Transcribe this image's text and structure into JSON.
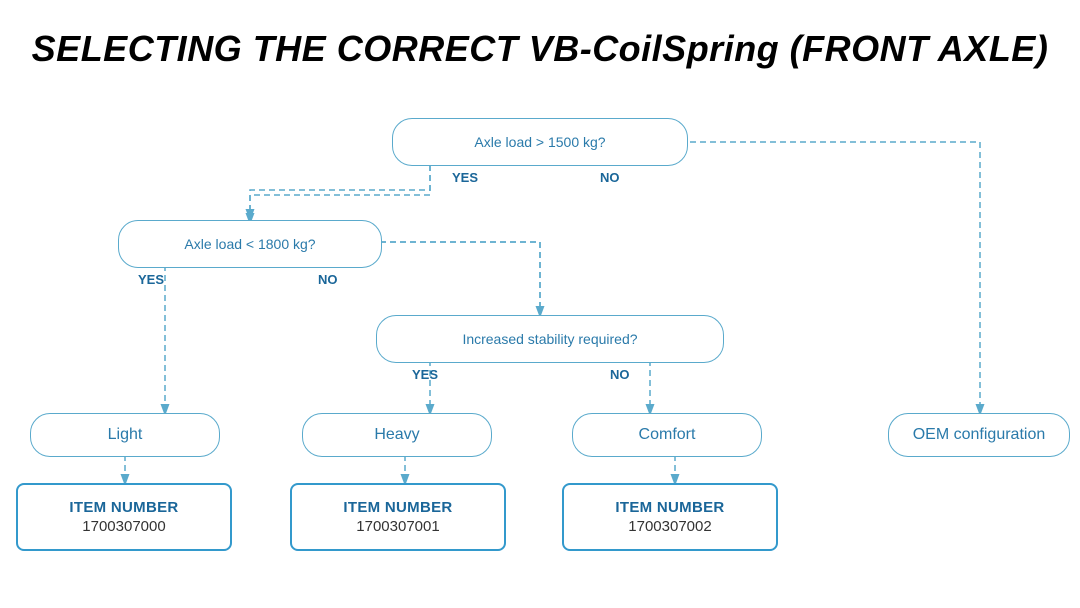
{
  "title": "SELECTING THE CORRECT VB-CoilSpring (FRONT AXLE)",
  "diagram": {
    "decision1": {
      "text": "Axle load > 1500 kg?",
      "yes": "YES",
      "no": "NO"
    },
    "decision2": {
      "text": "Axle load < 1800 kg?",
      "yes": "YES",
      "no": "NO"
    },
    "decision3": {
      "text": "Increased stability required?",
      "yes": "YES",
      "no": "NO"
    },
    "results": {
      "light": "Light",
      "heavy": "Heavy",
      "comfort": "Comfort",
      "oem": "OEM configuration"
    },
    "items": {
      "item0": {
        "label": "ITEM NUMBER",
        "number": "1700307000"
      },
      "item1": {
        "label": "ITEM NUMBER",
        "number": "1700307001"
      },
      "item2": {
        "label": "ITEM NUMBER",
        "number": "1700307002"
      }
    }
  }
}
